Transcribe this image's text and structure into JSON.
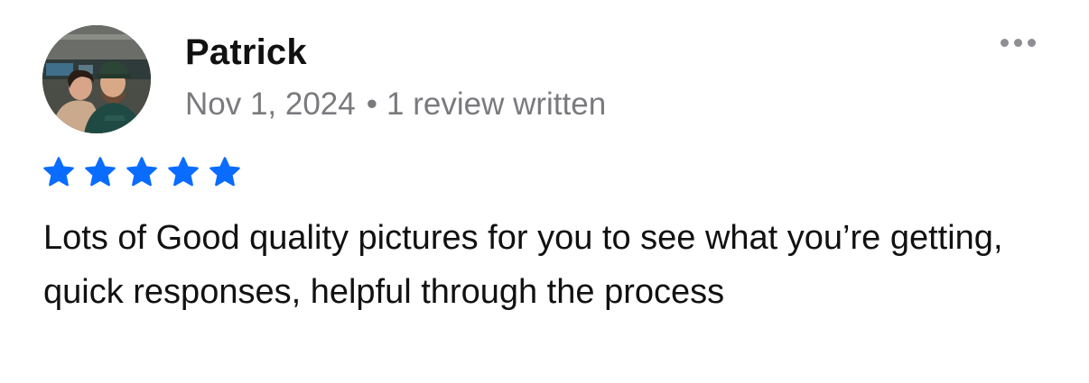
{
  "review": {
    "author": "Patrick",
    "date": "Nov 1, 2024",
    "separator": "•",
    "review_count": "1 review written",
    "rating": 5,
    "rating_max": 5,
    "text": "Lots of Good quality pictures for you to see what you’re getting, quick responses, helpful through the process"
  },
  "icons": {
    "more": "more-options-icon",
    "star": "star-icon"
  },
  "colors": {
    "star": "#0A6CFF",
    "meta_text": "#7A7A7E",
    "more_dots": "#8E8E93"
  }
}
